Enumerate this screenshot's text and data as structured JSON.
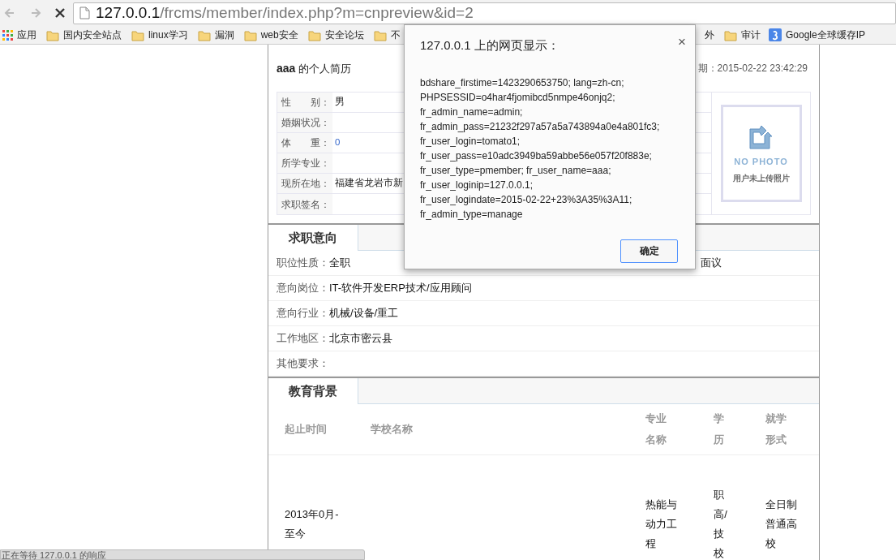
{
  "browser": {
    "url_host": "127.0.0.1",
    "url_path": "/frcms/member/index.php?m=cnpreview&id=2",
    "loading": true
  },
  "bookmarks": [
    {
      "kind": "apps",
      "label": "应用"
    },
    {
      "kind": "folder",
      "label": "国内安全站点"
    },
    {
      "kind": "folder",
      "label": "linux学习"
    },
    {
      "kind": "folder",
      "label": "漏洞"
    },
    {
      "kind": "folder",
      "label": "web安全"
    },
    {
      "kind": "folder",
      "label": "安全论坛"
    },
    {
      "kind": "folder",
      "label": "不"
    },
    {
      "kind": "folder_tail",
      "label": "外"
    },
    {
      "kind": "folder",
      "label": "审计"
    },
    {
      "kind": "google",
      "label": "Google全球缓存IP"
    }
  ],
  "resume": {
    "name": "aaa",
    "title_suffix": "的个人简历",
    "date_label": "期：",
    "date": "2015-02-22 23:42:29",
    "fields": [
      {
        "label": "性　　别：",
        "value": "男",
        "link": false
      },
      {
        "label": "婚姻状况："
      },
      {
        "label": "体　　重：",
        "value": "0",
        "link": true
      },
      {
        "label": "所学专业："
      },
      {
        "label": "现所在地：",
        "value": "福建省龙岩市新",
        "link": false
      },
      {
        "label": "求职签名："
      }
    ],
    "photo": {
      "caption_en": "NO PHOTO",
      "caption": "用户未上传照片"
    },
    "intent": {
      "tab": "求职意向",
      "first_row": [
        {
          "label": "职位性质：",
          "value": "全职"
        },
        {
          "value": "面议"
        }
      ],
      "rows": [
        {
          "label": "意向岗位：",
          "value": "IT-软件开发ERP技术/应用顾问"
        },
        {
          "label": "意向行业：",
          "value": "机械/设备/重工"
        },
        {
          "label": "工作地区：",
          "value": "北京市密云县"
        },
        {
          "label": "其他要求："
        }
      ]
    },
    "education": {
      "tab": "教育背景",
      "columns": [
        "起止时间",
        "学校名称",
        "专业名称",
        "学历",
        "就学形式"
      ],
      "rows": [
        [
          "2013年0月-至今",
          null,
          "热能与动力工程",
          "职高/技校",
          "全日制普通高校"
        ]
      ]
    }
  },
  "dialog": {
    "title": "127.0.0.1 上的网页显示：",
    "close": "×",
    "lines": [
      "bdshare_firstime=1423290653750; lang=zh-cn;",
      "PHPSESSID=o4har4fjomibcd5nmpe46onjq2;",
      "fr_admin_name=admin;",
      "fr_admin_pass=21232f297a57a5a743894a0e4a801fc3;",
      "fr_user_login=tomato1;",
      "fr_user_pass=e10adc3949ba59abbe56e057f20f883e;",
      "fr_user_type=pmember; fr_user_name=aaa;",
      "fr_user_loginip=127.0.0.1;",
      "fr_user_logindate=2015-02-22+23%3A35%3A11;",
      "fr_admin_type=manage"
    ],
    "button": "确定"
  },
  "status_bar": "正在等待 127.0.0.1 的响应"
}
